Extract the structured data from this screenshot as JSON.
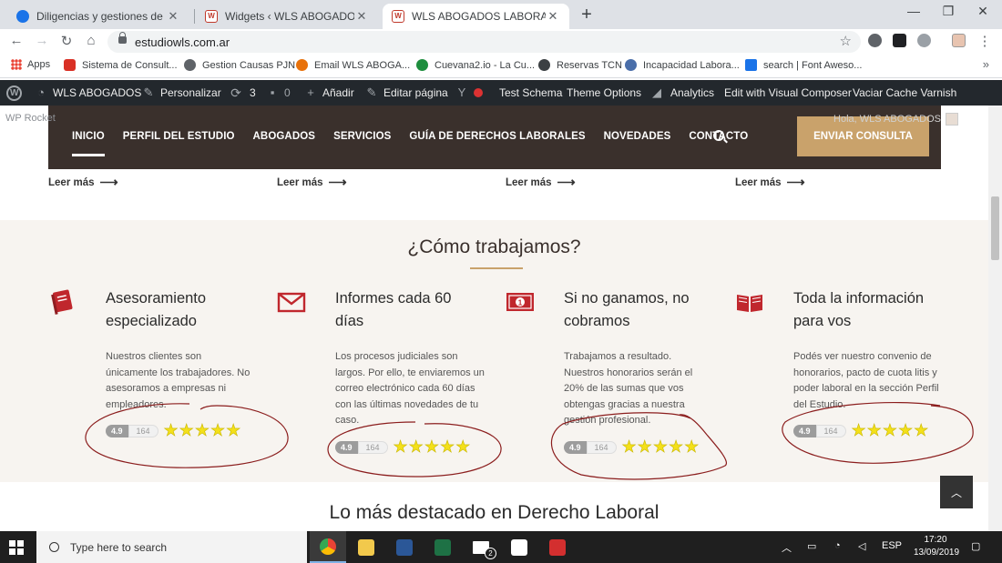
{
  "browser": {
    "tabs": [
      {
        "title": "Diligencias y gestiones de socied",
        "color": "#1a73e8"
      },
      {
        "title": "Widgets ‹ WLS ABOGADOS — W",
        "color": "#c0392b"
      },
      {
        "title": "WLS ABOGADOS LABORALES - R",
        "color": "#c0392b"
      }
    ],
    "new_tab": "+",
    "url": "estudiowls.com.ar",
    "bookmarks": [
      {
        "label": "Apps",
        "color": "#ea4335"
      },
      {
        "label": "Sistema de Consult...",
        "color": "#d93025"
      },
      {
        "label": "Gestion Causas PJN",
        "color": "#5f6368"
      },
      {
        "label": "Email WLS ABOGA...",
        "color": "#e8710a"
      },
      {
        "label": "Cuevana2.io - La Cu...",
        "color": "#1e8e3e"
      },
      {
        "label": "Reservas TCN",
        "color": "#3c4043"
      },
      {
        "label": "Incapacidad Labora...",
        "color": "#4a6ea9"
      },
      {
        "label": "search | Font Aweso...",
        "color": "#1a73e8"
      }
    ],
    "bookmarks_more": "»"
  },
  "adminbar": {
    "site": "WLS ABOGADOS",
    "customize": "Personalizar",
    "updates": "3",
    "comments": "0",
    "add": "Añadir",
    "edit_page": "Editar página",
    "test_schema": "Test Schema",
    "theme_options": "Theme Options",
    "analytics": "Analytics",
    "visual_composer": "Edit with Visual Composer",
    "varnish": "Vaciar Cache Varnish"
  },
  "site": {
    "wp_rocket": "WP Rocket",
    "greeting": "Hola, WLS ABOGADOS",
    "nav": [
      "INICIO",
      "PERFIL DEL ESTUDIO",
      "ABOGADOS",
      "SERVICIOS",
      "GUÍA DE DERECHOS LABORALES",
      "NOVEDADES",
      "CONTACTO"
    ],
    "cta": "ENVIAR CONSULTA",
    "read_more": "Leer más",
    "section_title": "¿Cómo trabajamos?",
    "features": [
      {
        "title_1": "Asesoramiento",
        "title_2": "especializado",
        "text": "Nuestros clientes son únicamente los trabajadores. No asesoramos a empresas ni empleadores.",
        "icon": "book-icon"
      },
      {
        "title_1": "Informes cada 60",
        "title_2": "días",
        "text": "Los procesos judiciales son largos. Por ello, te enviaremos un correo electrónico cada 60 días con las últimas novedades de tu caso.",
        "icon": "envelope-icon"
      },
      {
        "title_1": "Si no ganamos, no",
        "title_2": "cobramos",
        "text": "Trabajamos a resultado. Nuestros honorarios serán el 20% de las sumas que vos obtengas gracias a nuestra gestión profesional.",
        "icon": "money-icon"
      },
      {
        "title_1": "Toda la información",
        "title_2": "para vos",
        "text": "Podés ver nuestro convenio de honorarios, pacto de cuota litis y poder laboral en la sección Perfil del Estudio.",
        "icon": "open-book-icon"
      }
    ],
    "rating": {
      "score": "4.9",
      "count": "164",
      "stars": 5
    },
    "featured_title": "Lo más destacado en Derecho Laboral",
    "accent_color": "#c9a26b",
    "nav_bg": "#3a302c",
    "icon_color": "#c0272d"
  },
  "taskbar": {
    "search_placeholder": "Type here to search",
    "mail_badge": "2",
    "lang": "ESP",
    "time": "17:20",
    "date": "13/09/2019"
  }
}
